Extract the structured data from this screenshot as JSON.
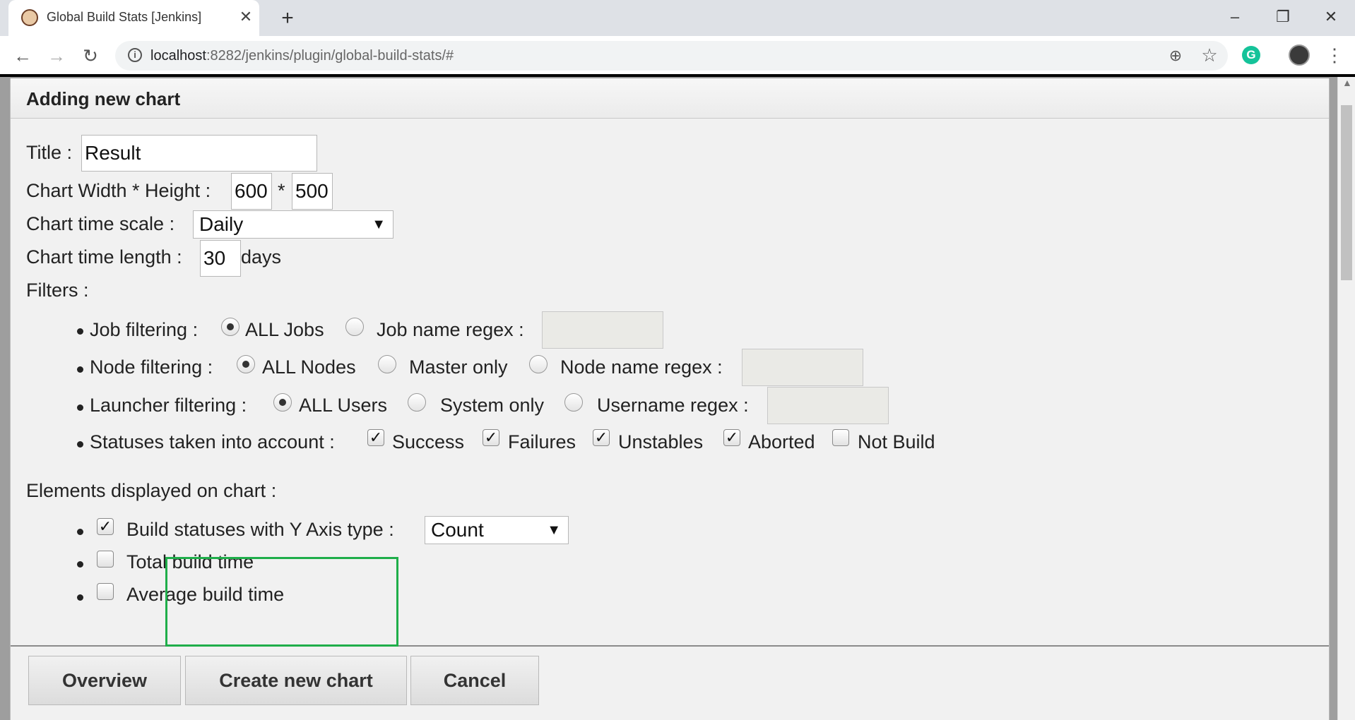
{
  "browser": {
    "tab_title": "Global Build Stats [Jenkins]",
    "url_host": "localhost",
    "url_path": ":8282/jenkins/plugin/global-build-stats/#"
  },
  "dialog": {
    "title": "Adding new chart",
    "title_label": "Title :",
    "title_value": "Result",
    "size_label": "Chart Width * Height :",
    "width_value": "600",
    "size_sep": "*",
    "height_value": "500",
    "scale_label": "Chart time scale :",
    "scale_value": "Daily",
    "length_label": "Chart time length :",
    "length_value": "30",
    "length_unit": "days",
    "filters_label": "Filters :",
    "job_filtering": {
      "label": "Job filtering :",
      "option_all": "ALL Jobs",
      "option_regex": "Job name regex :"
    },
    "node_filtering": {
      "label": "Node filtering :",
      "option_all": "ALL Nodes",
      "option_master": "Master only",
      "option_regex": "Node name regex :"
    },
    "launcher_filtering": {
      "label": "Launcher filtering :",
      "option_all": "ALL Users",
      "option_system": "System only",
      "option_regex": "Username regex :"
    },
    "statuses": {
      "label": "Statuses taken into account :",
      "success": "Success",
      "failures": "Failures",
      "unstables": "Unstables",
      "aborted": "Aborted",
      "not_build": "Not Build"
    },
    "elements_label": "Elements displayed on chart :",
    "elements": {
      "build_statuses": "Build statuses with Y Axis type :",
      "y_axis_value": "Count",
      "total_build_time": "Total build time",
      "average_build_time": "Average build time"
    },
    "buttons": {
      "overview": "Overview",
      "create": "Create new chart",
      "cancel": "Cancel"
    }
  }
}
